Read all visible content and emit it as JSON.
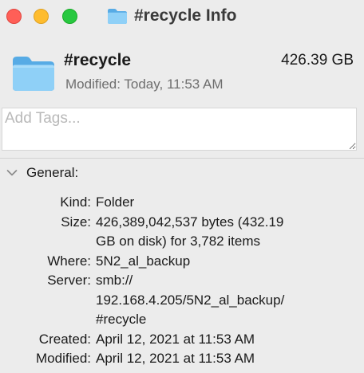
{
  "window": {
    "title": "#recycle Info",
    "title_icon": "folder-icon"
  },
  "traffic_lights": {
    "close": "#ff5f57",
    "minimize": "#febc2e",
    "zoom": "#28c840"
  },
  "header": {
    "name": "#recycle",
    "size": "426.39 GB",
    "modified": "Modified: Today, 11:53 AM",
    "icon": "folder-icon"
  },
  "tags": {
    "placeholder": "Add Tags...",
    "value": ""
  },
  "general": {
    "title": "General:",
    "expanded": true,
    "rows": [
      {
        "label": "Kind:",
        "lines": [
          "Folder"
        ]
      },
      {
        "label": "Size:",
        "lines": [
          "426,389,042,537 bytes (432.19",
          "GB on disk) for 3,782 items"
        ]
      },
      {
        "label": "Where:",
        "lines": [
          "5N2_al_backup"
        ]
      },
      {
        "label": "Server:",
        "lines": [
          "smb://",
          "192.168.4.205/5N2_al_backup/",
          "#recycle"
        ]
      },
      {
        "label": "Created:",
        "lines": [
          "April 12, 2021 at 11:53 AM"
        ]
      },
      {
        "label": "Modified:",
        "lines": [
          "April 12, 2021 at 11:53 AM"
        ]
      }
    ]
  },
  "colors": {
    "folder_light": "#8fd0f7",
    "folder_dark": "#57abe5",
    "background": "#ececec"
  }
}
